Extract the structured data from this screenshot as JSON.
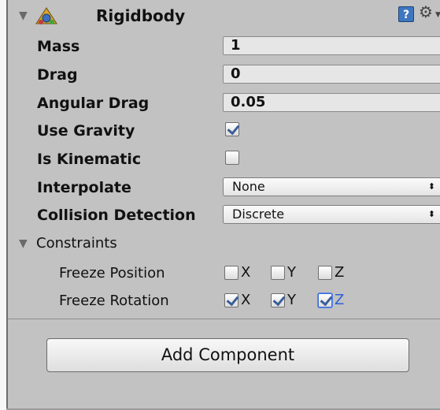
{
  "component": {
    "title": "Rigidbody"
  },
  "fields": {
    "mass": {
      "label": "Mass",
      "value": "1"
    },
    "drag": {
      "label": "Drag",
      "value": "0"
    },
    "angular_drag": {
      "label": "Angular Drag",
      "value": "0.05"
    },
    "use_gravity": {
      "label": "Use Gravity",
      "checked": true
    },
    "is_kinematic": {
      "label": "Is Kinematic",
      "checked": false
    },
    "interpolate": {
      "label": "Interpolate",
      "value": "None"
    },
    "collision_detection": {
      "label": "Collision Detection",
      "value": "Discrete"
    }
  },
  "constraints": {
    "label": "Constraints",
    "freeze_position": {
      "label": "Freeze Position",
      "x": {
        "label": "X",
        "checked": false
      },
      "y": {
        "label": "Y",
        "checked": false
      },
      "z": {
        "label": "Z",
        "checked": false
      }
    },
    "freeze_rotation": {
      "label": "Freeze Rotation",
      "x": {
        "label": "X",
        "checked": true
      },
      "y": {
        "label": "Y",
        "checked": true
      },
      "z": {
        "label": "Z",
        "checked": true
      }
    }
  },
  "add_component": {
    "label": "Add Component"
  },
  "icons": {
    "help": "?",
    "gear": "⚙",
    "dropdown_arrow": "⬍",
    "fold": "▼"
  },
  "colors": {
    "accent": "#3d77c0",
    "check": "#3a5f98",
    "focus": "#2f5fd6"
  }
}
